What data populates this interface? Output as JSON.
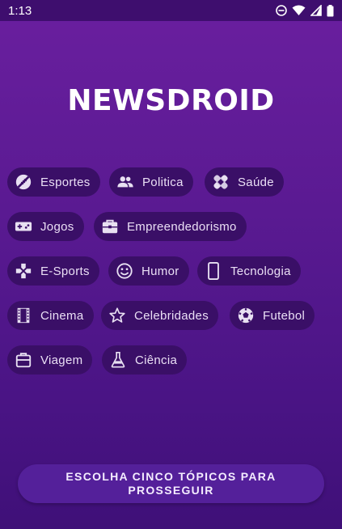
{
  "status_bar": {
    "time": "1:13"
  },
  "app": {
    "title": "NEWSDROID"
  },
  "topics": [
    {
      "label": "Esportes",
      "icon": "football-icon"
    },
    {
      "label": "Politica",
      "icon": "people-icon"
    },
    {
      "label": "Saúde",
      "icon": "bandage-icon"
    },
    {
      "label": "Jogos",
      "icon": "gamepad-icon"
    },
    {
      "label": "Empreendedorismo",
      "icon": "briefcase-icon"
    },
    {
      "label": "E-Sports",
      "icon": "dpad-icon"
    },
    {
      "label": "Humor",
      "icon": "smiley-icon"
    },
    {
      "label": "Tecnologia",
      "icon": "smartphone-icon"
    },
    {
      "label": "Cinema",
      "icon": "film-icon"
    },
    {
      "label": "Celebridades",
      "icon": "star-icon"
    },
    {
      "label": "Futebol",
      "icon": "soccer-ball-icon"
    },
    {
      "label": "Viagem",
      "icon": "luggage-icon"
    },
    {
      "label": "Ciência",
      "icon": "flask-icon"
    }
  ],
  "cta": {
    "label": "ESCOLHA CINCO TÓPICOS PARA PROSSEGUIR"
  },
  "colors": {
    "background_top": "#6a1f9f",
    "background_bottom": "#3f1078",
    "chip": "#3a0f67",
    "cta": "#54209a",
    "status_bar": "#3e0e6e"
  }
}
